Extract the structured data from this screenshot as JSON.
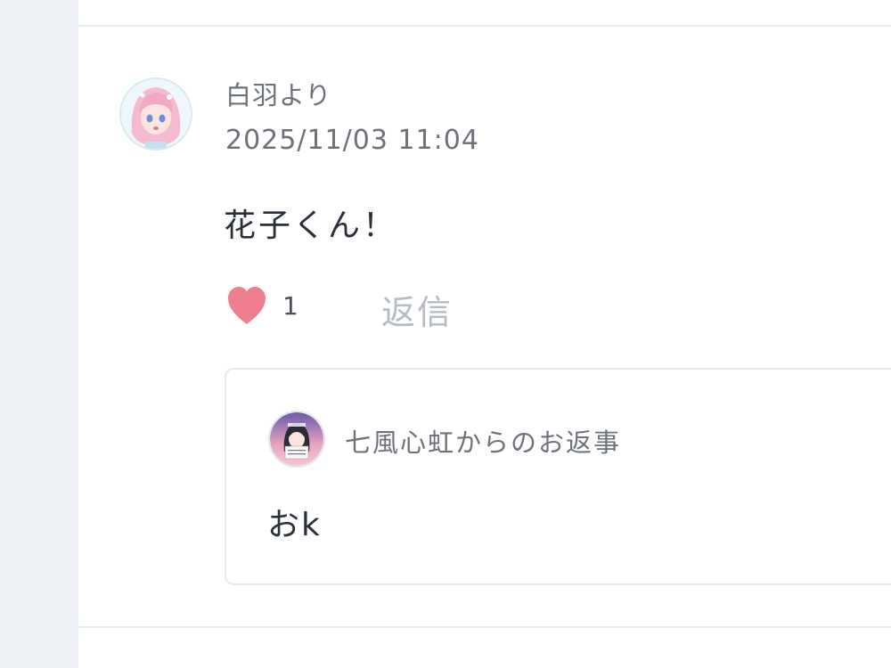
{
  "comment": {
    "author": "白羽より",
    "timestamp": "2025/11/03 11:04",
    "body": "花子くん！",
    "avatar_icon": "anime-girl-pink-hair-avatar",
    "likes": {
      "icon": "heart-icon",
      "count": "1",
      "color": "#ef7f8f"
    },
    "reply_label": "返信",
    "reply": {
      "title": "七風心虹からのお返事",
      "body": "おk",
      "avatar_icon": "anime-girl-dark-hair-avatar"
    }
  },
  "colors": {
    "sidebar": "#edf1f5",
    "divider": "#e6ecef",
    "muted_text": "#6d727a",
    "body_text": "#2a3039",
    "reply_button": "#b5bcc3"
  }
}
